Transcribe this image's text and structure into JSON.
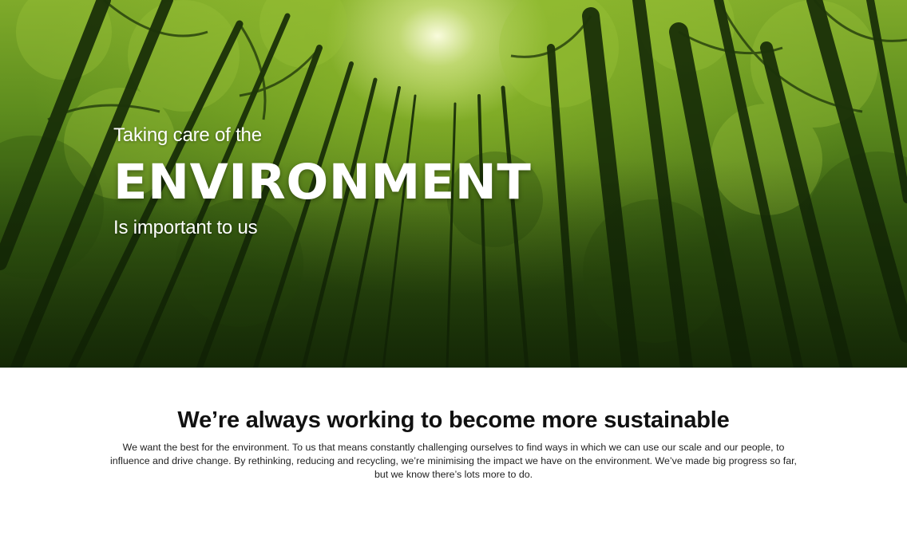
{
  "hero": {
    "line1": "Taking care of the",
    "title": "ENVIRONMENT",
    "line3": "Is important to us",
    "image": "forest-canopy-photo"
  },
  "content": {
    "heading": "We’re always working to become more sustainable",
    "body": "We want the best for the environment. To us that means constantly challenging ourselves to find ways in which we can use our scale and our people, to influence and drive change. By rethinking, reducing and recycling, we’re minimising the impact we have on the environment. We’ve made big progress so far, but we know there’s lots more to do."
  },
  "colors": {
    "canopy": "#6f9e23",
    "trunk": "#142606",
    "text_on_image": "#ffffff",
    "heading_text": "#111111",
    "body_text": "#222222"
  }
}
